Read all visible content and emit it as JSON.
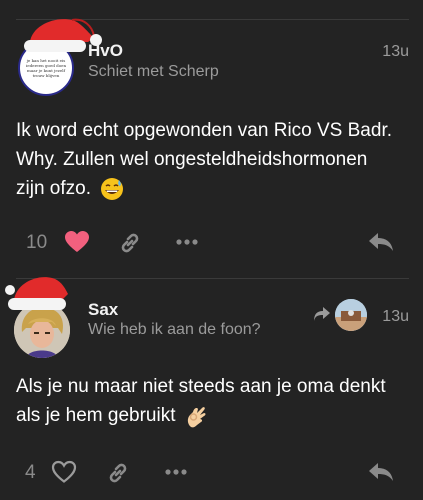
{
  "posts": [
    {
      "username": "HvO",
      "subtitle": "Schiet met Scherp",
      "time": "13u",
      "body_line1": "Ik word echt opgewonden van Rico VS Badr.",
      "body_line2": "Why. Zullen wel ongesteldheidshormonen",
      "body_line3": "zijn ofzo.",
      "emoji": "grinning-sweat-emoji",
      "like_count": "10",
      "liked": true,
      "avatar_text": "je kan het nooit eis iedereen goed doen maar je kunt jezelf trouw blijven"
    },
    {
      "username": "Sax",
      "subtitle": "Wie heb ik aan de foon?",
      "time": "13u",
      "body_line1": "Als je nu maar niet steeds aan je oma denkt",
      "body_line2": "als je hem gebruikt",
      "emoji": "ok-hand-emoji",
      "like_count": "4",
      "liked": false
    }
  ],
  "colors": {
    "background": "#232323",
    "heart_liked": "#f2607e",
    "muted": "#9b9b9b",
    "hat_red": "#e12b2b"
  }
}
